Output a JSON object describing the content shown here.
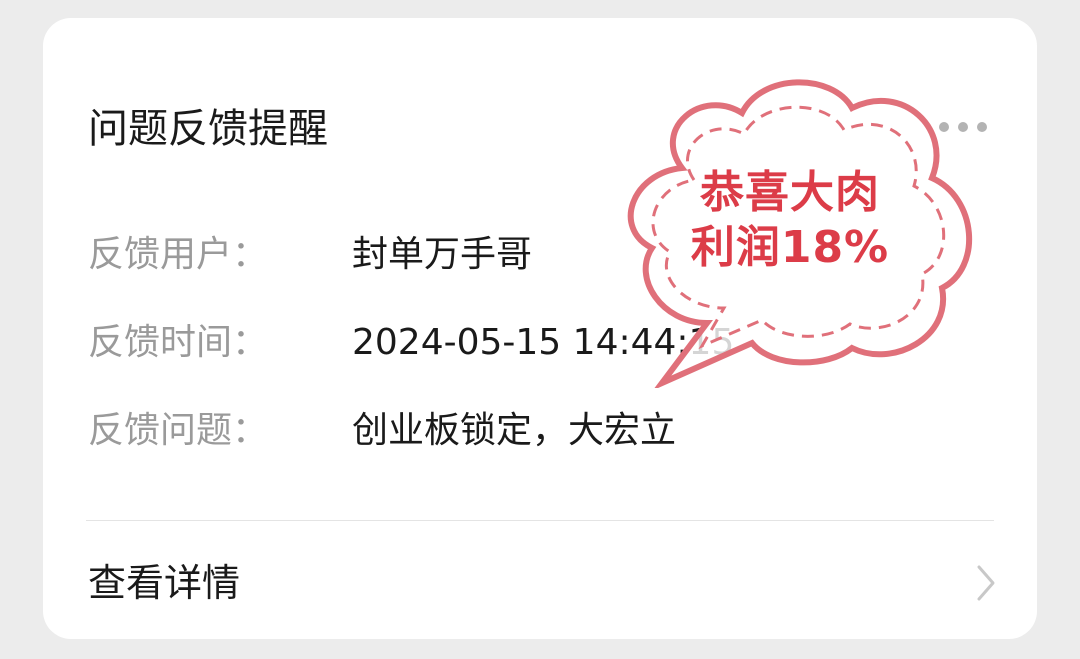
{
  "card": {
    "title": "问题反馈提醒",
    "fields": [
      {
        "label": "反馈用户：",
        "value": "封单万手哥"
      },
      {
        "label": "反馈时间：",
        "value": "2024-05-15 14:44:15"
      },
      {
        "label": "反馈问题：",
        "value": "创业板锁定，大宏立"
      }
    ],
    "detail_label": "查看详情"
  },
  "stamp": {
    "line1": "恭喜大肉",
    "line2": "利润18%",
    "color": "#dc3c48"
  },
  "icons": {
    "more": "more-horizontal-icon",
    "chevron": "chevron-right-icon"
  }
}
